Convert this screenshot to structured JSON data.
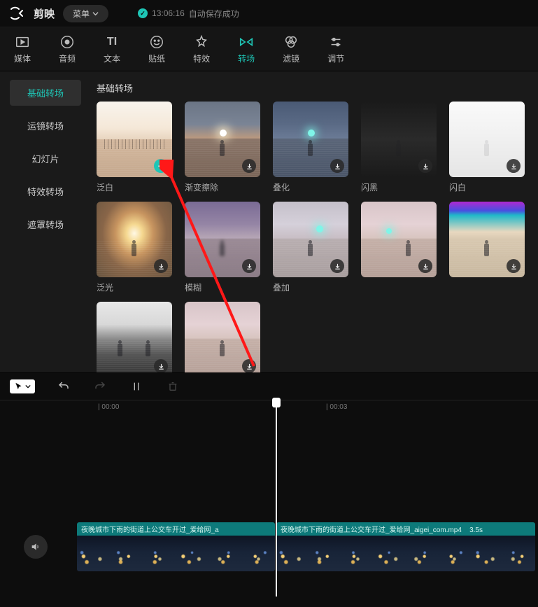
{
  "app_name": "剪映",
  "menu_label": "菜单",
  "autosave": {
    "time": "13:06:16",
    "text": "自动保存成功"
  },
  "tabs": [
    {
      "id": "media",
      "label": "媒体"
    },
    {
      "id": "audio",
      "label": "音频"
    },
    {
      "id": "text",
      "label": "文本"
    },
    {
      "id": "sticker",
      "label": "贴纸"
    },
    {
      "id": "effect",
      "label": "特效"
    },
    {
      "id": "transition",
      "label": "转场",
      "active": true
    },
    {
      "id": "filter",
      "label": "滤镜"
    },
    {
      "id": "adjust",
      "label": "调节"
    }
  ],
  "sidebar": [
    {
      "label": "基础转场",
      "active": true
    },
    {
      "label": "运镜转场"
    },
    {
      "label": "幻灯片"
    },
    {
      "label": "特效转场"
    },
    {
      "label": "遮罩转场"
    }
  ],
  "section_title": "基础转场",
  "cards": [
    {
      "label": "泛白",
      "badge": "add"
    },
    {
      "label": "渐变擦除",
      "badge": "download"
    },
    {
      "label": "叠化",
      "badge": "download"
    },
    {
      "label": "闪黑",
      "badge": "download"
    },
    {
      "label": "闪白",
      "badge": "download"
    },
    {
      "label": "泛光",
      "badge": "download"
    },
    {
      "label": "模糊",
      "badge": "download"
    },
    {
      "label": "叠加",
      "badge": "download"
    },
    {
      "label": "",
      "badge": "download"
    },
    {
      "label": "",
      "badge": "download"
    },
    {
      "label": "",
      "badge": "download"
    },
    {
      "label": "",
      "badge": "download"
    }
  ],
  "ruler": {
    "t0": "00:00",
    "t1": "00:03"
  },
  "clips": [
    {
      "title": "夜晚城市下雨的街道上公交车开过_爱给网_a"
    },
    {
      "title": "夜晚城市下雨的街道上公交车开过_爱给网_aigei_com.mp4",
      "dur": "3.5s"
    }
  ]
}
